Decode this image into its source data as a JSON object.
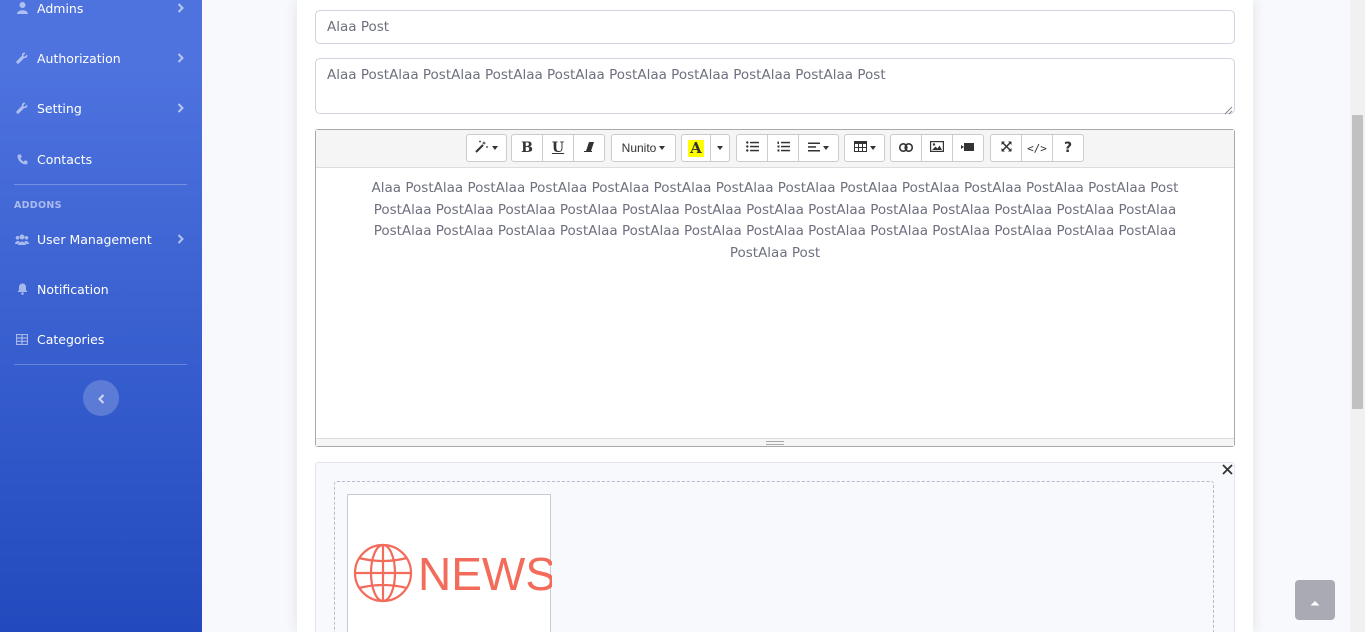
{
  "sidebar": {
    "items": [
      {
        "label": "Admins",
        "icon": "user-icon",
        "has_chevron": true
      },
      {
        "label": "Authorization",
        "icon": "wrench-icon",
        "has_chevron": true
      },
      {
        "label": "Setting",
        "icon": "wrench-icon",
        "has_chevron": true
      },
      {
        "label": "Contacts",
        "icon": "phone-icon",
        "has_chevron": false
      }
    ],
    "addons_heading": "ADDONS",
    "addon_items": [
      {
        "label": "User Management",
        "icon": "users-icon",
        "has_chevron": true
      },
      {
        "label": "Notification",
        "icon": "bell-icon",
        "has_chevron": false
      },
      {
        "label": "Categories",
        "icon": "table-icon",
        "has_chevron": false
      }
    ],
    "toggle_icon": "chevron-left-icon"
  },
  "form": {
    "title_value": "Alaa Post",
    "summary_value": "Alaa PostAlaa PostAlaa PostAlaa PostAlaa PostAlaa PostAlaa PostAlaa PostAlaa Post",
    "body_lines": [
      "Alaa PostAlaa PostAlaa PostAlaa PostAlaa PostAlaa PostAlaa PostAlaa PostAlaa PostAlaa PostAlaa PostAlaa PostAlaa Post",
      "PostAlaa PostAlaa PostAlaa PostAlaa PostAlaa PostAlaa PostAlaa PostAlaa PostAlaa PostAlaa PostAlaa PostAlaa PostAlaa",
      "PostAlaa PostAlaa PostAlaa PostAlaa PostAlaa PostAlaa PostAlaa PostAlaa PostAlaa PostAlaa PostAlaa PostAlaa PostAlaa",
      "PostAlaa Post"
    ]
  },
  "toolbar": {
    "font_name": "Nunito",
    "buttons": [
      "magic-icon",
      "bold-icon",
      "underline-icon",
      "eraser-icon",
      "font-color-icon",
      "unordered-list-icon",
      "ordered-list-icon",
      "align-icon",
      "table-icon",
      "link-icon",
      "picture-icon",
      "video-icon",
      "fullscreen-icon",
      "code-view-icon",
      "help-icon"
    ],
    "bold_label": "B",
    "underline_label": "U",
    "color_label": "A",
    "code_label": "</>",
    "help_label": "?",
    "font_color": "#ffff00"
  },
  "image_preview": {
    "text": "NEWS",
    "color": "#f26b5b"
  },
  "colors": {
    "sidebar_top": "#4e73df",
    "sidebar_bottom": "#224abe"
  }
}
